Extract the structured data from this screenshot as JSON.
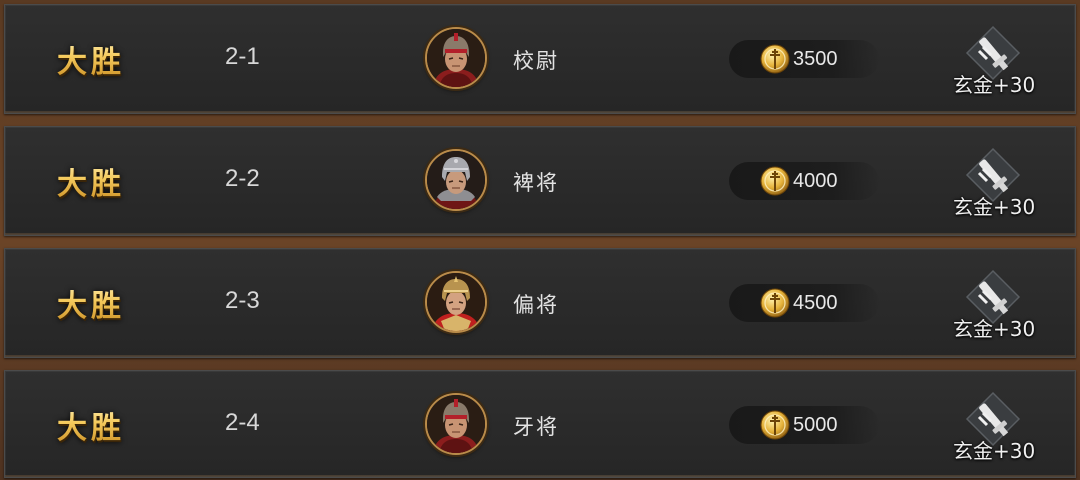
{
  "battles": [
    {
      "result": "大胜",
      "stage": "2-1",
      "rank": "校尉",
      "coins": "3500",
      "item_reward": "玄金+30",
      "portrait_icon": "general-portrait-red-armor",
      "armor_color": "#8b1d1d"
    },
    {
      "result": "大胜",
      "stage": "2-2",
      "rank": "裨将",
      "coins": "4000",
      "item_reward": "玄金+30",
      "portrait_icon": "general-portrait-silver-helmet",
      "armor_color": "#6f1616"
    },
    {
      "result": "大胜",
      "stage": "2-3",
      "rank": "偏将",
      "coins": "4500",
      "item_reward": "玄金+30",
      "portrait_icon": "general-portrait-gold-helmet",
      "armor_color": "#c0201e"
    },
    {
      "result": "大胜",
      "stage": "2-4",
      "rank": "牙将",
      "coins": "5000",
      "item_reward": "玄金+30",
      "portrait_icon": "general-portrait-red-armor",
      "armor_color": "#8b1d1d"
    }
  ],
  "colors": {
    "victory_gold": "#f3cc6a",
    "row_background": "#2a2a2a",
    "page_background": "#5a3a22"
  }
}
